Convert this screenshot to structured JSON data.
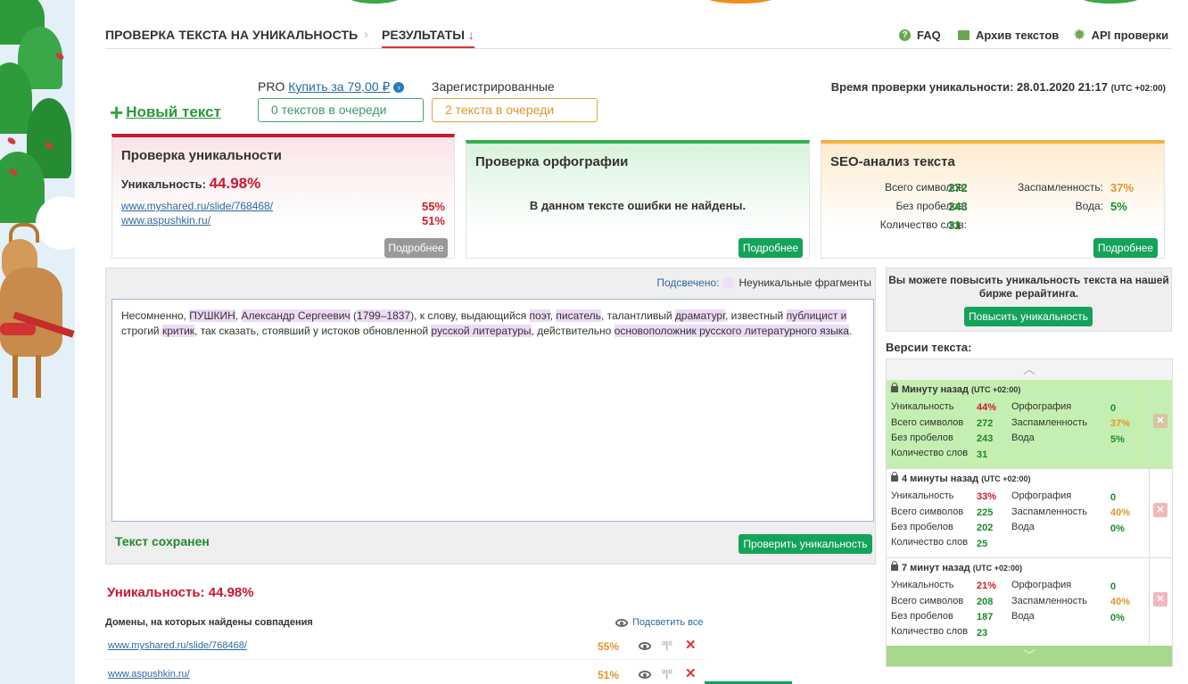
{
  "nav": {
    "crumb1": "ПРОВЕРКА ТЕКСТА НА УНИКАЛЬНОСТЬ",
    "sep": "›",
    "crumb2": "РЕЗУЛЬТАТЫ",
    "crumb2_arrow": "↓",
    "links": [
      {
        "label": "FAQ",
        "icon": "question-icon"
      },
      {
        "label": "Архив текстов",
        "icon": "archive-icon"
      },
      {
        "label": "API проверки",
        "icon": "gear-icon"
      }
    ]
  },
  "queue": {
    "new_text": "Новый текст",
    "pro_prefix": "PRO",
    "pro_link": "Купить за 79,00 ₽",
    "pro_queue": "0 текстов в очереди",
    "reg_label": "Зарегистрированные",
    "reg_queue": "2 текста в очереди",
    "check_time_label": "Время проверки уникальности: 28.01.2020 21:17",
    "check_time_tz": "(UTC +02:00)"
  },
  "uniq_card": {
    "title": "Проверка уникальности",
    "label": "Уникальность:",
    "value": "44.98%",
    "sources": [
      {
        "url": "www.myshared.ru/slide/768468/",
        "pct": "55%"
      },
      {
        "url": "www.aspushkin.ru/",
        "pct": "51%"
      }
    ],
    "more": "Подробнее"
  },
  "spell_card": {
    "title": "Проверка орфографии",
    "message": "В данном тексте ошибки не найдены.",
    "more": "Подробнее"
  },
  "seo_card": {
    "title": "SEO-анализ текста",
    "total_label": "Всего символов:",
    "total": "272",
    "nospace_label": "Без пробелов:",
    "nospace": "243",
    "words_label": "Количество слов:",
    "words": "31",
    "spam_label": "Заспамленность:",
    "spam": "37%",
    "water_label": "Вода:",
    "water": "5%",
    "more": "Подробнее"
  },
  "editor": {
    "legend_key": "Подсвечено:",
    "legend_text": "Неуникальные фрагменты",
    "saved": "Текст сохранен",
    "check_button": "Проверить уникальность",
    "segments": [
      {
        "t": "Несомненно, ",
        "h": false
      },
      {
        "t": "ПУШКИН",
        "h": true
      },
      {
        "t": ", ",
        "h": false
      },
      {
        "t": "Александр Сергеевич",
        "h": true
      },
      {
        "t": " (",
        "h": false
      },
      {
        "t": "1799–1837",
        "h": true
      },
      {
        "t": "), к слову, выдающийся ",
        "h": false
      },
      {
        "t": "поэт",
        "h": true
      },
      {
        "t": ", ",
        "h": false
      },
      {
        "t": "писатель",
        "h": true
      },
      {
        "t": ", талантливый ",
        "h": false
      },
      {
        "t": "драматург",
        "h": true
      },
      {
        "t": ", известный ",
        "h": false
      },
      {
        "t": "публицист и",
        "h": true
      },
      {
        "t": " строгий ",
        "h": false
      },
      {
        "t": "критик",
        "h": true
      },
      {
        "t": ", так сказать, стоявший у истоков обновленной ",
        "h": false
      },
      {
        "t": "русской литературы",
        "h": true
      },
      {
        "t": ", действительно ",
        "h": false
      },
      {
        "t": "основоположник русского литературного языка",
        "h": true
      },
      {
        "t": ".",
        "h": false
      }
    ]
  },
  "results": {
    "uniq_line": "Уникальность: 44.98%",
    "domains_title": "Домены, на которых найдены совпадения",
    "highlight_all": "Подсветить все",
    "domains": [
      {
        "url": "www.myshared.ru/slide/768468/",
        "pct": "55%"
      },
      {
        "url": "www.aspushkin.ru/",
        "pct": "51%"
      }
    ]
  },
  "promo": {
    "text": "Вы можете повысить уникальность текста на нашей бирже рерайтинга.",
    "button": "Повысить уникальность"
  },
  "versions": {
    "title": "Версии текста:",
    "labels": {
      "uniq": "Уникальность",
      "total": "Всего символов",
      "nospace": "Без пробелов",
      "words": "Количество слов",
      "spell": "Орфография",
      "spam": "Заспамленность",
      "water": "Вода"
    },
    "items": [
      {
        "when": "Минуту назад",
        "tz": "(UTC +02:00)",
        "uniq": "44%",
        "total": "272",
        "nospace": "243",
        "words": "31",
        "spell": "0",
        "spam": "37%",
        "water": "5%"
      },
      {
        "when": "4 минуты назад",
        "tz": "(UTC +02:00)",
        "uniq": "33%",
        "total": "225",
        "nospace": "202",
        "words": "25",
        "spell": "0",
        "spam": "40%",
        "water": "0%"
      },
      {
        "when": "7 минут назад",
        "tz": "(UTC +02:00)",
        "uniq": "21%",
        "total": "208",
        "nospace": "187",
        "words": "23",
        "spell": "0",
        "spam": "40%",
        "water": "0%"
      }
    ]
  }
}
